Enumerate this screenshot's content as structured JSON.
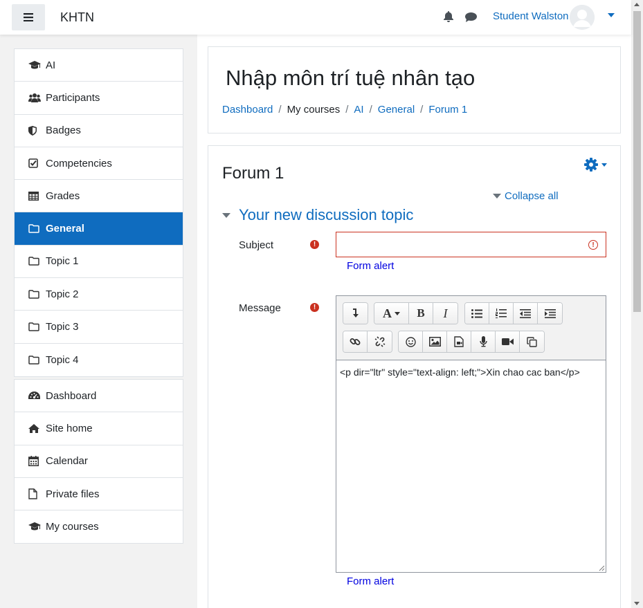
{
  "navbar": {
    "menu_icon": "hamburger-icon",
    "brand": "KHTN",
    "notification_icon": "bell-icon",
    "messages_icon": "chat-icon",
    "user_name": "Student Walston"
  },
  "sidebar": {
    "course_items": [
      {
        "label": "AI",
        "icon": "graduation-cap-icon"
      },
      {
        "label": "Participants",
        "icon": "users-icon"
      },
      {
        "label": "Badges",
        "icon": "shield-icon"
      },
      {
        "label": "Competencies",
        "icon": "check-square-icon"
      },
      {
        "label": "Grades",
        "icon": "table-icon"
      },
      {
        "label": "General",
        "icon": "folder-icon",
        "active": true
      },
      {
        "label": "Topic 1",
        "icon": "folder-icon"
      },
      {
        "label": "Topic 2",
        "icon": "folder-icon"
      },
      {
        "label": "Topic 3",
        "icon": "folder-icon"
      },
      {
        "label": "Topic 4",
        "icon": "folder-icon"
      }
    ],
    "site_items": [
      {
        "label": "Dashboard",
        "icon": "dashboard-icon"
      },
      {
        "label": "Site home",
        "icon": "home-icon"
      },
      {
        "label": "Calendar",
        "icon": "calendar-icon"
      },
      {
        "label": "Private files",
        "icon": "file-icon"
      },
      {
        "label": "My courses",
        "icon": "graduation-cap-icon"
      }
    ]
  },
  "header": {
    "title": "Nhập môn trí tuệ nhân tạo",
    "breadcrumb": [
      "Dashboard",
      "My courses",
      "AI",
      "General",
      "Forum 1"
    ],
    "breadcrumb_sep": "/"
  },
  "forum": {
    "title": "Forum 1",
    "collapse_all": "Collapse all",
    "section_title": "Your new discussion topic",
    "subject_label": "Subject",
    "subject_value": "",
    "subject_alert": "Form alert",
    "message_label": "Message",
    "message_value": "<p dir=\"ltr\" style=\"text-align: left;\">Xin chao cac ban</p>",
    "message_alert": "Form alert"
  },
  "colors": {
    "primary": "#0f6cbf",
    "danger": "#ca3120",
    "alert_link": "#0000e0"
  }
}
